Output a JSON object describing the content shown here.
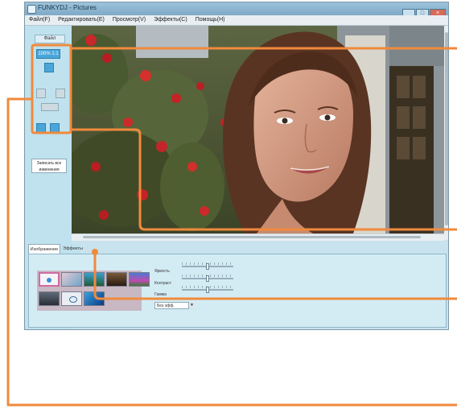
{
  "window": {
    "title": "FUNKYDJ - Pictures",
    "controls": [
      "_",
      "□",
      "×"
    ]
  },
  "menu": [
    "Файл(F)",
    "Редактировать(E)",
    "Просмотр(V)",
    "Эффекты(C)",
    "Помощь(H)"
  ],
  "left_panel": {
    "tab_label": "Файл",
    "zoom_label": "100% 1:1",
    "save_label": "Записать все изменения"
  },
  "bottom_panel": {
    "tabs": [
      "Изображение",
      "Эффекты"
    ],
    "sliders": [
      {
        "label": "Яркость",
        "value": 0.5
      },
      {
        "label": "Контраст",
        "value": 0.5
      },
      {
        "label": "Гамма",
        "value": 0.5
      }
    ],
    "preset_label": "Без эфф.",
    "preset_arrow": "▼"
  },
  "colors": {
    "callout": "#f08a3c",
    "window_bg": "#c9e3ee",
    "panel_bg": "#bfe2ee",
    "selected_thumb": "#d06aa0"
  }
}
